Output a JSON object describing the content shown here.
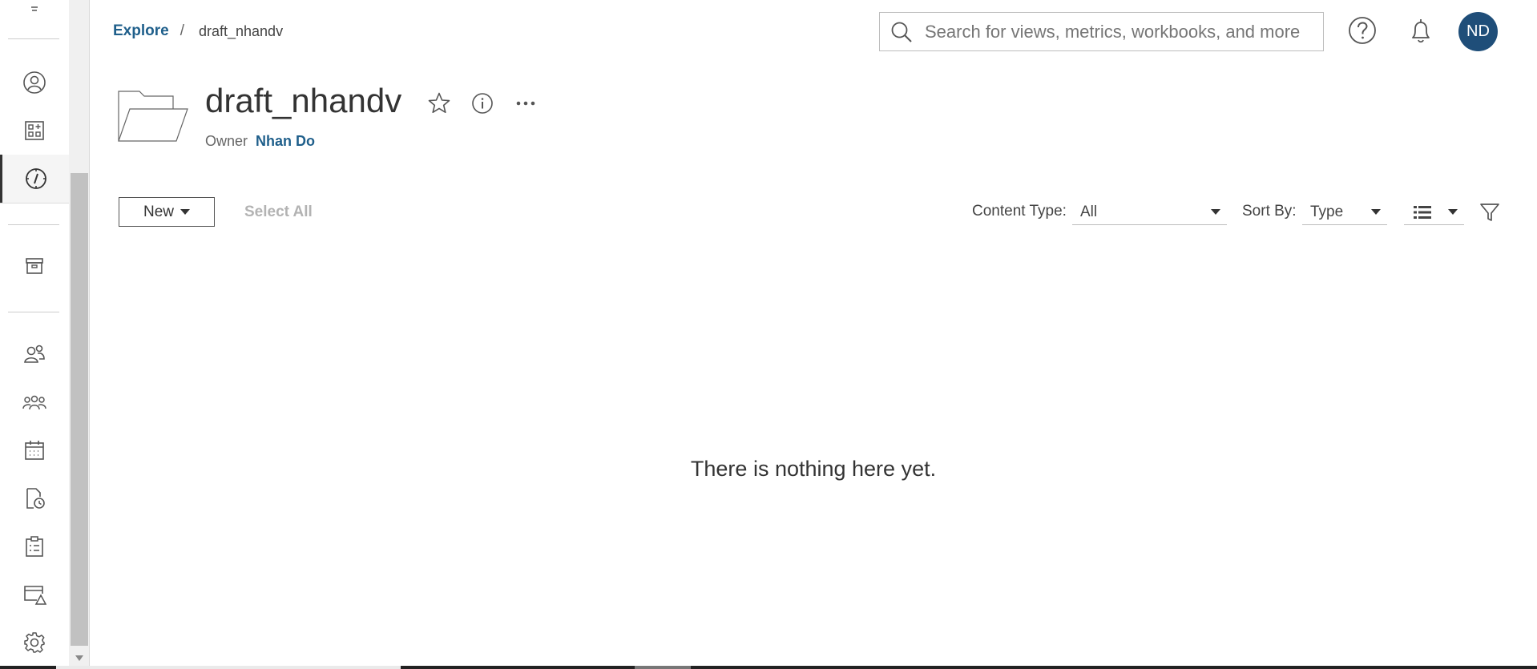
{
  "rail": {
    "items": [
      {
        "name": "profile",
        "icon": "user-circle-icon"
      },
      {
        "name": "home",
        "icon": "apps-grid-icon"
      },
      {
        "name": "explore",
        "icon": "compass-icon",
        "active": true
      },
      {
        "name": "collections",
        "icon": "archive-box-icon"
      },
      {
        "name": "users",
        "icon": "users-icon"
      },
      {
        "name": "groups",
        "icon": "groups-icon"
      },
      {
        "name": "schedules",
        "icon": "calendar-icon"
      },
      {
        "name": "jobs",
        "icon": "document-clock-icon"
      },
      {
        "name": "tasks",
        "icon": "clipboard-icon"
      },
      {
        "name": "site-status",
        "icon": "window-warning-icon"
      },
      {
        "name": "settings",
        "icon": "gear-icon"
      }
    ]
  },
  "breadcrumb": {
    "root": "Explore",
    "separator": "/",
    "current": "draft_nhandv"
  },
  "search": {
    "placeholder": "Search for views, metrics, workbooks, and more"
  },
  "user": {
    "initials": "ND"
  },
  "project": {
    "title": "draft_nhandv",
    "owner_label": "Owner",
    "owner_name": "Nhan Do"
  },
  "toolbar": {
    "new_label": "New",
    "select_all_label": "Select All",
    "content_type_label": "Content Type:",
    "content_type_value": "All",
    "sort_by_label": "Sort By:",
    "sort_by_value": "Type"
  },
  "empty_state": {
    "message": "There is nothing here yet."
  },
  "colors": {
    "link": "#1f5f8b",
    "avatar": "#1f4e79",
    "disabled": "#b3b3b3"
  }
}
